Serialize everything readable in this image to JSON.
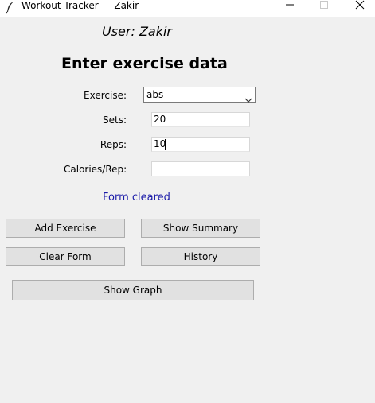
{
  "window": {
    "title": "Workout Tracker — Zakir"
  },
  "user_label": "User: Zakir",
  "heading": "Enter exercise data",
  "form": {
    "exercise_label": "Exercise:",
    "exercise_value": "abs",
    "sets_label": "Sets:",
    "sets_value": "20",
    "reps_label": "Reps:",
    "reps_value": "10",
    "calories_label": "Calories/Rep:",
    "calories_value": ""
  },
  "status_message": "Form cleared",
  "buttons": {
    "add_exercise": "Add Exercise",
    "show_summary": "Show Summary",
    "clear_form": "Clear Form",
    "history": "History",
    "show_graph": "Show Graph"
  },
  "colors": {
    "status_text": "#1a1aa8",
    "button_bg": "#e1e1e1",
    "window_bg": "#f0f0f0"
  }
}
